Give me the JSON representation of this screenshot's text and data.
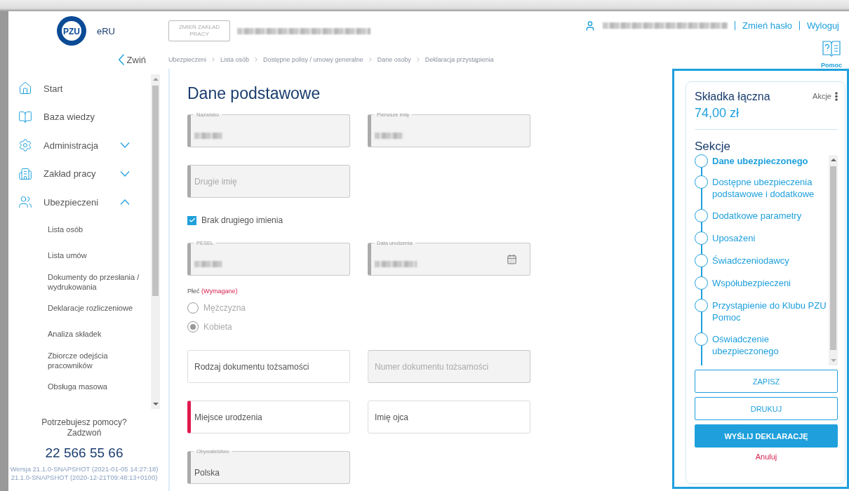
{
  "header": {
    "logo_mark": "PZU",
    "app_name": "eRU",
    "change_button": "ZMIEŃ ZAKŁAD PRACY",
    "company": {
      "redacted": true
    },
    "user": {
      "redacted": true
    },
    "links": [
      "Zmień hasło",
      "Wyloguj"
    ],
    "help": "Pomoc",
    "collapse": "Zwiń"
  },
  "breadcrumbs": [
    "Ubezpieczeni",
    "Lista osób",
    "Dostępne polisy / umowy generalne",
    "Dane osoby",
    "Deklaracja przystąpienia"
  ],
  "sidebar": {
    "items": [
      {
        "label": "Start",
        "kind": "home"
      },
      {
        "label": "Baza wiedzy",
        "kind": "book"
      },
      {
        "label": "Administracja",
        "kind": "gear",
        "expanded": false
      },
      {
        "label": "Zakład pracy",
        "kind": "building",
        "expanded": false
      },
      {
        "label": "Ubezpieczeni",
        "kind": "people",
        "expanded": true,
        "children": [
          "Lista osób",
          "Lista umów",
          "Dokumenty do przesłania / wydrukowania",
          "Deklaracje rozliczeniowe",
          "Analiza składek",
          "Zbiorcze odejścia pracowników",
          "Obsługa masowa"
        ]
      }
    ],
    "help_text": "Potrzebujesz pomocy? Zadzwoń",
    "phone": "22 566 55 66",
    "version": [
      "Wersja 21.1.0-SNAPSHOT (2021-01-05 14:27:18)",
      "21.1.0-SNAPSHOT (2020-12-21T09:48:13+0100)"
    ]
  },
  "form": {
    "title": "Dane podstawowe",
    "rows": [
      [
        {
          "kind": "field",
          "label": "Nazwisko",
          "redacted": true,
          "disabled": true,
          "required": true,
          "invalid": false
        },
        {
          "kind": "field",
          "label": "Pierwsze imię",
          "redacted": true,
          "disabled": true,
          "required": true,
          "invalid": false
        }
      ],
      [
        {
          "kind": "field",
          "placeholder": "Drugie imię",
          "disabled": true,
          "required": true,
          "invalid": false
        }
      ],
      [
        {
          "kind": "checkbox",
          "label": "Brak drugiego imienia",
          "checked": true
        }
      ],
      [
        {
          "kind": "field",
          "label": "PESEL",
          "redacted": true,
          "disabled": true,
          "required": true,
          "invalid": false
        },
        {
          "kind": "field",
          "label": "Data urodzenia",
          "redacted": true,
          "disabled": true,
          "required": true,
          "invalid": false,
          "calendar": true
        }
      ],
      [
        {
          "kind": "radio",
          "label": "Płeć",
          "note": "(Wymagane)",
          "disabled": true,
          "options": [
            {
              "label": "Mężczyzna",
              "selected": false
            },
            {
              "label": "Kobieta",
              "selected": true
            }
          ]
        }
      ],
      [
        {
          "kind": "field",
          "placeholder": "Rodzaj dokumentu tożsamości",
          "disabled": false,
          "required": false,
          "invalid": false
        },
        {
          "kind": "field",
          "placeholder": "Numer dokumentu tożsamości",
          "disabled": true,
          "required": false,
          "invalid": false
        }
      ],
      [
        {
          "kind": "field",
          "placeholder": "Miejsce urodzenia",
          "disabled": false,
          "required": true,
          "invalid": true
        },
        {
          "kind": "field",
          "placeholder": "Imię ojca",
          "disabled": false,
          "required": false,
          "invalid": false
        }
      ],
      [
        {
          "kind": "field",
          "label": "Obywatelstwo",
          "value": "Polska",
          "disabled": true,
          "required": true,
          "invalid": false
        }
      ]
    ]
  },
  "summary": {
    "title": "Składka łączna",
    "amount": "74,00 zł",
    "actions": "Akcje",
    "sections_title": "Sekcje",
    "sections": [
      {
        "label": "Dane ubezpieczonego",
        "selected": true
      },
      {
        "label": "Dostępne ubezpieczenia podstawowe i dodatkowe",
        "selected": false
      },
      {
        "label": "Dodatkowe parametry",
        "selected": false
      },
      {
        "label": "Uposażeni",
        "selected": false
      },
      {
        "label": "Świadczeniodawcy",
        "selected": false
      },
      {
        "label": "Współubezpieczeni",
        "selected": false
      },
      {
        "label": "Przystąpienie do Klubu PZU Pomoc",
        "selected": false
      },
      {
        "label": "Oświadczenie ubezpieczonego",
        "selected": false
      }
    ],
    "buttons": [
      {
        "label": "ZAPISZ",
        "kind": "outline"
      },
      {
        "label": "DRUKUJ",
        "kind": "outline"
      },
      {
        "label": "WYŚLIJ DEKLARACJĘ",
        "kind": "primary"
      }
    ],
    "cancel": "Anuluj"
  }
}
